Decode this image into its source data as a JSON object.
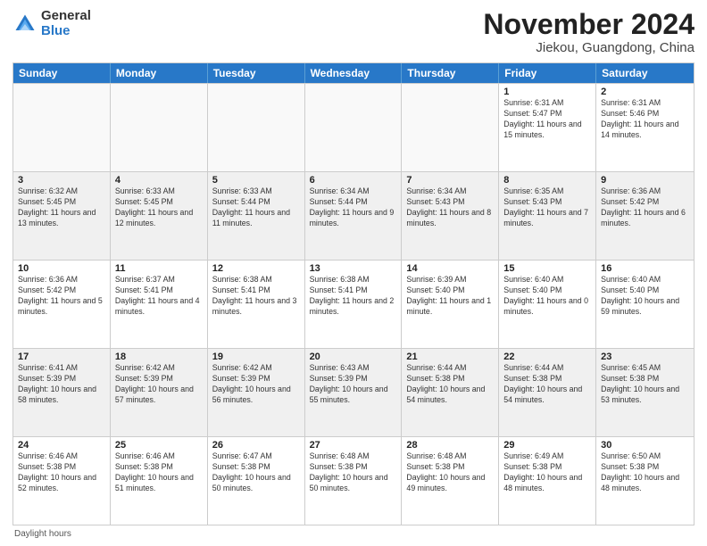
{
  "header": {
    "logo_general": "General",
    "logo_blue": "Blue",
    "title": "November 2024",
    "location": "Jiekou, Guangdong, China"
  },
  "days_of_week": [
    "Sunday",
    "Monday",
    "Tuesday",
    "Wednesday",
    "Thursday",
    "Friday",
    "Saturday"
  ],
  "weeks": [
    [
      {
        "day": "",
        "empty": true
      },
      {
        "day": "",
        "empty": true
      },
      {
        "day": "",
        "empty": true
      },
      {
        "day": "",
        "empty": true
      },
      {
        "day": "",
        "empty": true
      },
      {
        "day": "1",
        "sunrise": "6:31 AM",
        "sunset": "5:47 PM",
        "daylight": "11 hours and 15 minutes."
      },
      {
        "day": "2",
        "sunrise": "6:31 AM",
        "sunset": "5:46 PM",
        "daylight": "11 hours and 14 minutes."
      }
    ],
    [
      {
        "day": "3",
        "sunrise": "6:32 AM",
        "sunset": "5:45 PM",
        "daylight": "11 hours and 13 minutes."
      },
      {
        "day": "4",
        "sunrise": "6:33 AM",
        "sunset": "5:45 PM",
        "daylight": "11 hours and 12 minutes."
      },
      {
        "day": "5",
        "sunrise": "6:33 AM",
        "sunset": "5:44 PM",
        "daylight": "11 hours and 11 minutes."
      },
      {
        "day": "6",
        "sunrise": "6:34 AM",
        "sunset": "5:44 PM",
        "daylight": "11 hours and 9 minutes."
      },
      {
        "day": "7",
        "sunrise": "6:34 AM",
        "sunset": "5:43 PM",
        "daylight": "11 hours and 8 minutes."
      },
      {
        "day": "8",
        "sunrise": "6:35 AM",
        "sunset": "5:43 PM",
        "daylight": "11 hours and 7 minutes."
      },
      {
        "day": "9",
        "sunrise": "6:36 AM",
        "sunset": "5:42 PM",
        "daylight": "11 hours and 6 minutes."
      }
    ],
    [
      {
        "day": "10",
        "sunrise": "6:36 AM",
        "sunset": "5:42 PM",
        "daylight": "11 hours and 5 minutes."
      },
      {
        "day": "11",
        "sunrise": "6:37 AM",
        "sunset": "5:41 PM",
        "daylight": "11 hours and 4 minutes."
      },
      {
        "day": "12",
        "sunrise": "6:38 AM",
        "sunset": "5:41 PM",
        "daylight": "11 hours and 3 minutes."
      },
      {
        "day": "13",
        "sunrise": "6:38 AM",
        "sunset": "5:41 PM",
        "daylight": "11 hours and 2 minutes."
      },
      {
        "day": "14",
        "sunrise": "6:39 AM",
        "sunset": "5:40 PM",
        "daylight": "11 hours and 1 minute."
      },
      {
        "day": "15",
        "sunrise": "6:40 AM",
        "sunset": "5:40 PM",
        "daylight": "11 hours and 0 minutes."
      },
      {
        "day": "16",
        "sunrise": "6:40 AM",
        "sunset": "5:40 PM",
        "daylight": "10 hours and 59 minutes."
      }
    ],
    [
      {
        "day": "17",
        "sunrise": "6:41 AM",
        "sunset": "5:39 PM",
        "daylight": "10 hours and 58 minutes."
      },
      {
        "day": "18",
        "sunrise": "6:42 AM",
        "sunset": "5:39 PM",
        "daylight": "10 hours and 57 minutes."
      },
      {
        "day": "19",
        "sunrise": "6:42 AM",
        "sunset": "5:39 PM",
        "daylight": "10 hours and 56 minutes."
      },
      {
        "day": "20",
        "sunrise": "6:43 AM",
        "sunset": "5:39 PM",
        "daylight": "10 hours and 55 minutes."
      },
      {
        "day": "21",
        "sunrise": "6:44 AM",
        "sunset": "5:38 PM",
        "daylight": "10 hours and 54 minutes."
      },
      {
        "day": "22",
        "sunrise": "6:44 AM",
        "sunset": "5:38 PM",
        "daylight": "10 hours and 54 minutes."
      },
      {
        "day": "23",
        "sunrise": "6:45 AM",
        "sunset": "5:38 PM",
        "daylight": "10 hours and 53 minutes."
      }
    ],
    [
      {
        "day": "24",
        "sunrise": "6:46 AM",
        "sunset": "5:38 PM",
        "daylight": "10 hours and 52 minutes."
      },
      {
        "day": "25",
        "sunrise": "6:46 AM",
        "sunset": "5:38 PM",
        "daylight": "10 hours and 51 minutes."
      },
      {
        "day": "26",
        "sunrise": "6:47 AM",
        "sunset": "5:38 PM",
        "daylight": "10 hours and 50 minutes."
      },
      {
        "day": "27",
        "sunrise": "6:48 AM",
        "sunset": "5:38 PM",
        "daylight": "10 hours and 50 minutes."
      },
      {
        "day": "28",
        "sunrise": "6:48 AM",
        "sunset": "5:38 PM",
        "daylight": "10 hours and 49 minutes."
      },
      {
        "day": "29",
        "sunrise": "6:49 AM",
        "sunset": "5:38 PM",
        "daylight": "10 hours and 48 minutes."
      },
      {
        "day": "30",
        "sunrise": "6:50 AM",
        "sunset": "5:38 PM",
        "daylight": "10 hours and 48 minutes."
      }
    ]
  ],
  "footer": {
    "daylight_label": "Daylight hours"
  }
}
